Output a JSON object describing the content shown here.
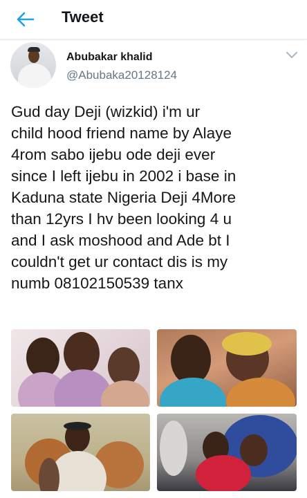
{
  "header": {
    "title": "Tweet",
    "back_icon": "back-arrow-icon"
  },
  "author": {
    "name": "Abubakar khalid",
    "handle": "@Abubaka20128124"
  },
  "tweet": {
    "text": "Gud day Deji (wizkid) i'm ur\nchild hood friend name by Alaye\n4rom sabo ijebu ode deji ever\nsince I left ijebu in 2002 i base in\nKaduna state Nigeria Deji 4More\nthan 12yrs I hv been looking 4 u\nand I ask moshood and Ade bt I\ncouldn't get ur contact dis is my\nnumb 08102150539 tanx"
  },
  "colors": {
    "accent": "#1da1f2",
    "text": "#14171a",
    "secondary": "#657786"
  },
  "media_count": 4
}
